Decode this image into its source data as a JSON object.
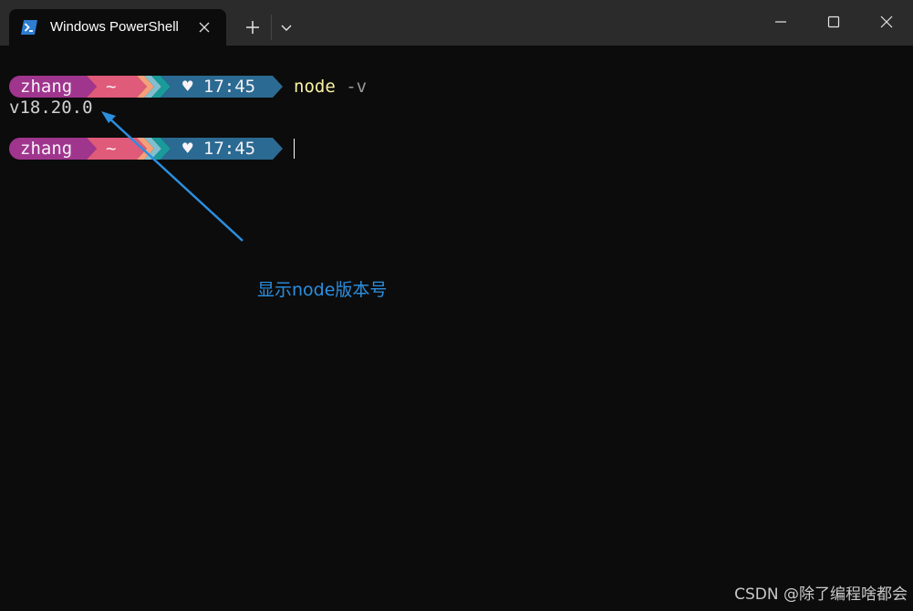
{
  "window": {
    "tab_title": "Windows PowerShell",
    "tab_icon": "powershell-icon",
    "controls": [
      "minimize-icon",
      "maximize-icon",
      "close-icon"
    ]
  },
  "terminal": {
    "lines": [
      {
        "prompt": {
          "user": "zhang",
          "dir": "~",
          "time_icon": "heart-icon",
          "time": "♥ 17:45"
        },
        "command": "node",
        "argument": "-v"
      },
      {
        "output": "v18.20.0"
      },
      {
        "prompt": {
          "user": "zhang",
          "dir": "~",
          "time_icon": "heart-icon",
          "time": "♥ 17:45"
        },
        "command": "",
        "argument": ""
      }
    ]
  },
  "annotation": {
    "text": "显示node版本号",
    "color": "#2b8fe0"
  },
  "watermark": "CSDN @除了编程啥都会",
  "colors": {
    "user_segment": "#a0358e",
    "dir_segment": "#e05a7a",
    "time_segment": "#2b6a92",
    "command": "#f9f1a5",
    "background": "#0c0c0c",
    "titlebar": "#2b2b2b"
  }
}
